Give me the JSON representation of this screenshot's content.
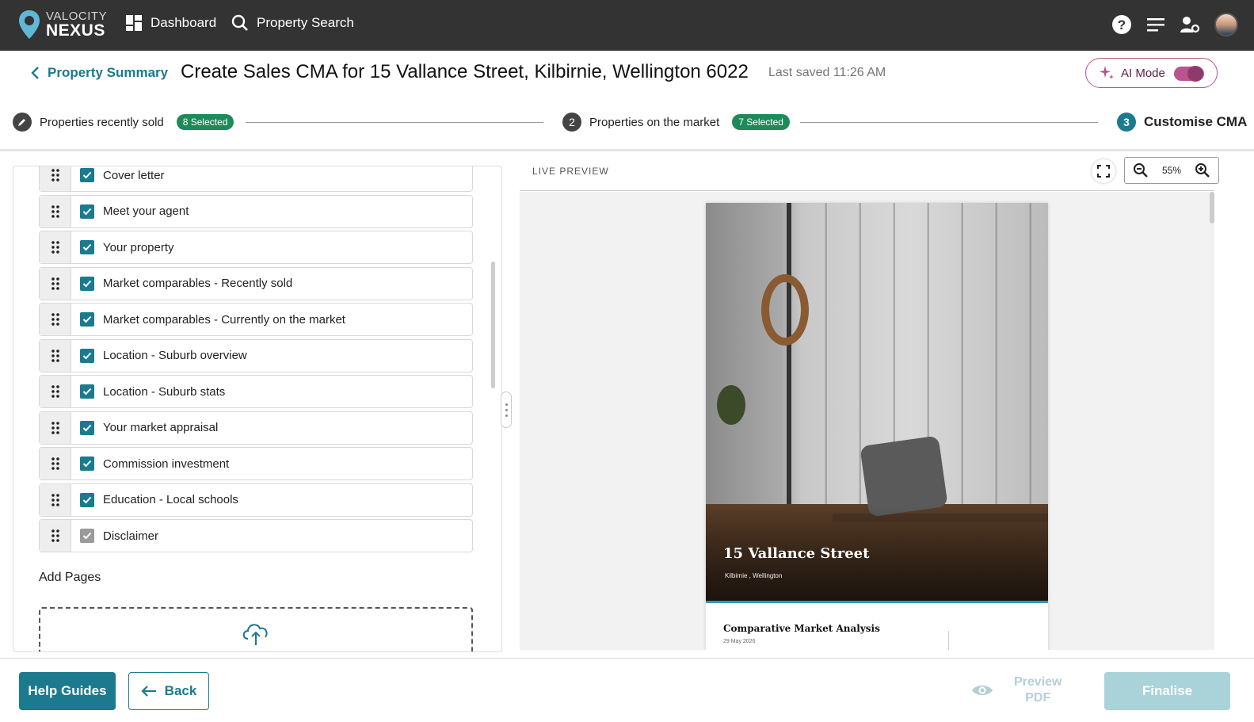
{
  "brand": {
    "line1": "VALOCITY",
    "line2": "NEXUS",
    "accent": "#1b7a8e"
  },
  "nav": {
    "dashboard": "Dashboard",
    "property_search": "Property Search",
    "icons": [
      "help-icon",
      "menu-icon",
      "user-settings-icon",
      "avatar"
    ]
  },
  "header": {
    "back_label": "Property Summary",
    "title": "Create Sales CMA for 15 Vallance Street, Kilbirnie, Wellington 6022",
    "last_saved": "Last saved 11:26 AM",
    "ai_mode_label": "AI Mode",
    "ai_mode_on": true
  },
  "stepper": {
    "steps": [
      {
        "number": "",
        "label": "Properties recently sold",
        "badge": "8 Selected"
      },
      {
        "number": "2",
        "label": "Properties on the market",
        "badge": "7 Selected"
      },
      {
        "number": "3",
        "label": "Customise CMA",
        "badge": ""
      }
    ]
  },
  "pages": {
    "items": [
      {
        "label": "Cover letter",
        "checked": true
      },
      {
        "label": "Meet your agent",
        "checked": true
      },
      {
        "label": "Your property",
        "checked": true
      },
      {
        "label": "Market comparables - Recently sold",
        "checked": true
      },
      {
        "label": "Market comparables - Currently on the market",
        "checked": true
      },
      {
        "label": "Location - Suburb overview",
        "checked": true
      },
      {
        "label": "Location - Suburb stats",
        "checked": true
      },
      {
        "label": "Your market appraisal",
        "checked": true
      },
      {
        "label": "Commission investment",
        "checked": true
      },
      {
        "label": "Education - Local schools",
        "checked": true
      },
      {
        "label": "Disclaimer",
        "checked": true,
        "disabled": true
      }
    ],
    "add_pages_label": "Add Pages"
  },
  "preview": {
    "title": "LIVE PREVIEW",
    "zoom": "55%",
    "doc": {
      "address": "15 Vallance Street",
      "suburb": "Kilbirnie , Wellington",
      "heading": "Comparative Market Analysis",
      "date": "29 May 2026"
    }
  },
  "footer": {
    "help": "Help Guides",
    "back": "Back",
    "preview_pdf_line1": "Preview",
    "preview_pdf_line2": "PDF",
    "finalise": "Finalise"
  }
}
